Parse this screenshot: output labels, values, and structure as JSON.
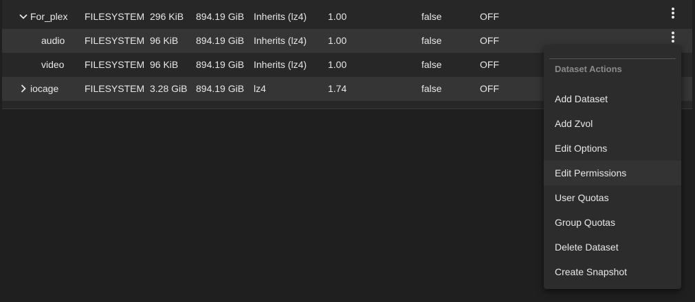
{
  "table": {
    "rows": [
      {
        "name": "For_plex",
        "type": "FILESYSTEM",
        "used": "296 KiB",
        "available": "894.19 GiB",
        "compression": "Inherits (lz4)",
        "ratio": "1.00",
        "readonly": "false",
        "dedup": "OFF",
        "expander": "expanded",
        "level": 0
      },
      {
        "name": "audio",
        "type": "FILESYSTEM",
        "used": "96 KiB",
        "available": "894.19 GiB",
        "compression": "Inherits (lz4)",
        "ratio": "1.00",
        "readonly": "false",
        "dedup": "OFF",
        "expander": "none",
        "level": 1
      },
      {
        "name": "video",
        "type": "FILESYSTEM",
        "used": "96 KiB",
        "available": "894.19 GiB",
        "compression": "Inherits (lz4)",
        "ratio": "1.00",
        "readonly": "false",
        "dedup": "OFF",
        "expander": "none",
        "level": 1
      },
      {
        "name": "iocage",
        "type": "FILESYSTEM",
        "used": "3.28 GiB",
        "available": "894.19 GiB",
        "compression": "lz4",
        "ratio": "1.74",
        "readonly": "false",
        "dedup": "OFF",
        "expander": "collapsed",
        "level": 0
      }
    ]
  },
  "menu": {
    "header": "Dataset Actions",
    "items": [
      {
        "label": "Add Dataset"
      },
      {
        "label": "Add Zvol"
      },
      {
        "label": "Edit Options"
      },
      {
        "label": "Edit Permissions"
      },
      {
        "label": "User Quotas"
      },
      {
        "label": "Group Quotas"
      },
      {
        "label": "Delete Dataset"
      },
      {
        "label": "Create Snapshot"
      }
    ]
  },
  "icons": {
    "expanded": "chevron-down-icon",
    "collapsed": "chevron-right-icon",
    "actions": "more-vertical-icon"
  },
  "colors": {
    "background": "#1f1f1f",
    "table_bg": "#272727",
    "row_alt": "#353535",
    "menu_bg": "#2c2c2c",
    "text": "#e8e8e8",
    "menu_header": "#8a8a8a"
  }
}
